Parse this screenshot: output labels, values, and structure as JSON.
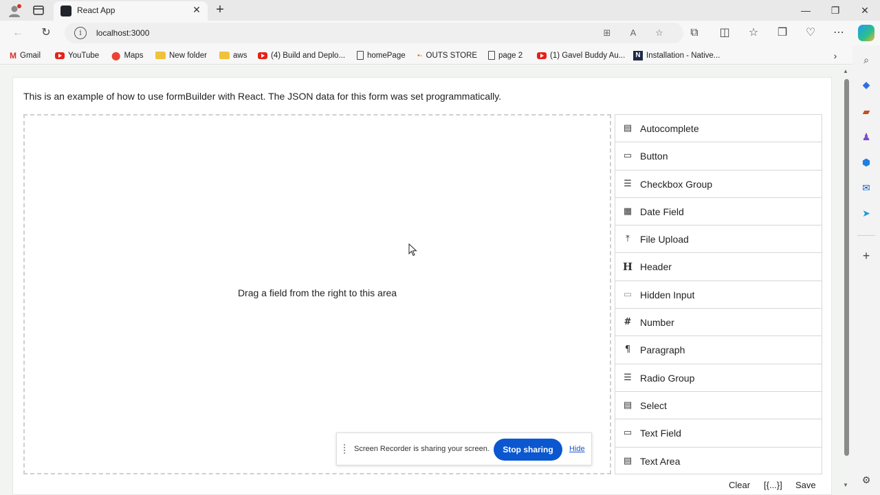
{
  "browser": {
    "tab_title": "React App",
    "url": "localhost:3000",
    "bookmarks": [
      {
        "label": "Gmail",
        "icon": "gmail-icon"
      },
      {
        "label": "YouTube",
        "icon": "youtube-icon"
      },
      {
        "label": "Maps",
        "icon": "maps-icon"
      },
      {
        "label": "New folder",
        "icon": "folder-icon"
      },
      {
        "label": "aws",
        "icon": "folder-icon"
      },
      {
        "label": "(4) Build and Deplo...",
        "icon": "youtube-icon"
      },
      {
        "label": "homePage",
        "icon": "page-icon"
      },
      {
        "label": "OUTS STORE",
        "icon": "outs-store-icon"
      },
      {
        "label": "page 2",
        "icon": "page-icon"
      },
      {
        "label": "(1) Gavel Buddy Au...",
        "icon": "youtube-icon"
      },
      {
        "label": "Installation - Native...",
        "icon": "nativescript-icon"
      }
    ]
  },
  "page": {
    "intro": "This is an example of how to use formBuilder with React. The JSON data for this form was set programmatically.",
    "dropzone_text": "Drag a field from the right to this area",
    "fields": [
      {
        "label": "Autocomplete",
        "icon": "autocomplete-icon"
      },
      {
        "label": "Button",
        "icon": "button-icon"
      },
      {
        "label": "Checkbox Group",
        "icon": "checkbox-group-icon"
      },
      {
        "label": "Date Field",
        "icon": "calendar-icon"
      },
      {
        "label": "File Upload",
        "icon": "upload-icon"
      },
      {
        "label": "Header",
        "icon": "header-icon"
      },
      {
        "label": "Hidden Input",
        "icon": "hidden-input-icon"
      },
      {
        "label": "Number",
        "icon": "hash-icon"
      },
      {
        "label": "Paragraph",
        "icon": "paragraph-icon"
      },
      {
        "label": "Radio Group",
        "icon": "radio-group-icon"
      },
      {
        "label": "Select",
        "icon": "select-icon"
      },
      {
        "label": "Text Field",
        "icon": "text-field-icon"
      },
      {
        "label": "Text Area",
        "icon": "text-area-icon"
      }
    ],
    "actions": {
      "clear": "Clear",
      "json": "[{...}]",
      "save": "Save"
    }
  },
  "share_banner": {
    "text": "Screen Recorder is sharing your screen.",
    "stop": "Stop sharing",
    "hide": "Hide"
  },
  "colors": {
    "share_button": "#0b57d0",
    "youtube": "#e62117"
  }
}
